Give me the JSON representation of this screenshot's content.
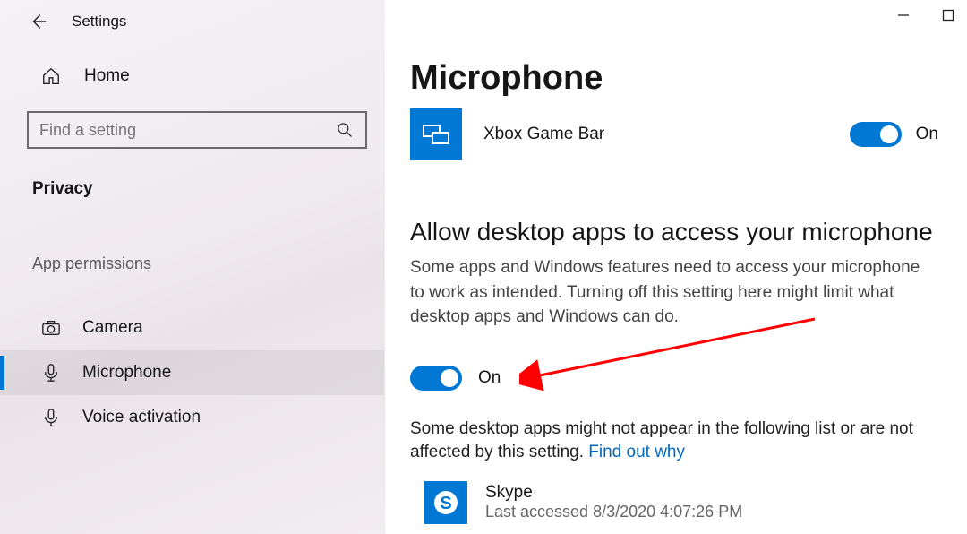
{
  "window": {
    "title": "Settings"
  },
  "sidebar": {
    "home_label": "Home",
    "search_placeholder": "Find a setting",
    "section_title": "Privacy",
    "group_label": "App permissions",
    "items": [
      {
        "label": "Camera"
      },
      {
        "label": "Microphone"
      },
      {
        "label": "Voice activation"
      }
    ]
  },
  "main": {
    "heading": "Microphone",
    "xbox": {
      "name": "Xbox Game Bar",
      "toggle_state": "On"
    },
    "desktop_section": {
      "heading": "Allow desktop apps to access your microphone",
      "description": "Some apps and Windows features need to access your microphone to work as intended. Turning off this setting here might limit what desktop apps and Windows can do.",
      "toggle_state": "On",
      "note_prefix": "Some desktop apps might not appear in the following list or are not affected by this setting. ",
      "note_link": "Find out why"
    },
    "desktop_apps": [
      {
        "name": "Skype",
        "last_accessed": "Last accessed 8/3/2020 4:07:26 PM"
      }
    ]
  }
}
